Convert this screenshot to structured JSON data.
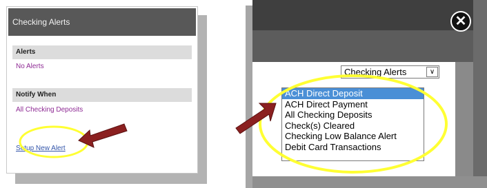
{
  "left_panel": {
    "header_title": "Checking Alerts",
    "alerts_section": {
      "title": "Alerts",
      "value": "No Alerts"
    },
    "notify_section": {
      "title": "Notify When",
      "value": "All Checking Deposits"
    },
    "setup_link": "Setup New Alert"
  },
  "right_panel": {
    "close_icon": "close-icon",
    "select": {
      "selected": "Checking Alerts",
      "arrow": "∨"
    },
    "dropdown_options": [
      {
        "label": "ACH Direct Deposit",
        "highlighted": true
      },
      {
        "label": "ACH Direct Payment",
        "highlighted": false
      },
      {
        "label": "All Checking Deposits",
        "highlighted": false
      },
      {
        "label": "Check(s) Cleared",
        "highlighted": false
      },
      {
        "label": "Checking Low Balance Alert",
        "highlighted": false
      },
      {
        "label": "Debit Card Transactions",
        "highlighted": false
      }
    ]
  },
  "colors": {
    "header_bg": "#585858",
    "link_purple": "#8e2a94",
    "link_blue": "#3355aa",
    "highlight_circle": "#ffff33",
    "arrow": "#8b2020",
    "selected_option": "#4a8fd6"
  }
}
